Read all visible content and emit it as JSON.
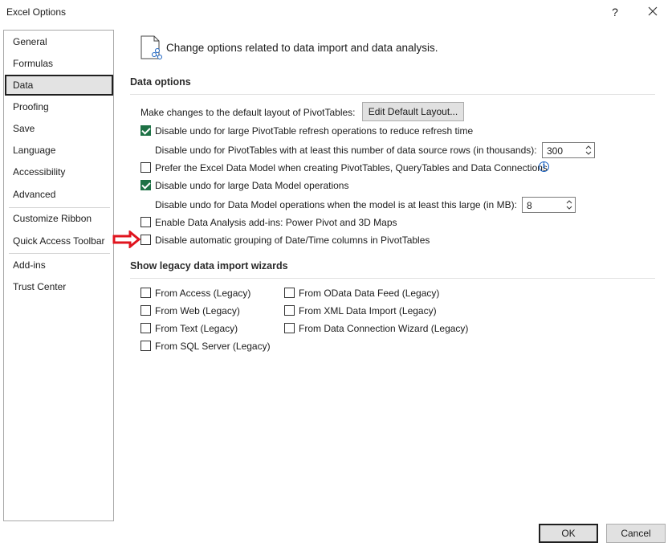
{
  "window": {
    "title": "Excel Options",
    "help_glyph": "?",
    "close_icon": "close-icon"
  },
  "sidebar": {
    "items": [
      {
        "label": "General",
        "selected": false
      },
      {
        "label": "Formulas",
        "selected": false
      },
      {
        "label": "Data",
        "selected": true
      },
      {
        "label": "Proofing",
        "selected": false
      },
      {
        "label": "Save",
        "selected": false
      },
      {
        "label": "Language",
        "selected": false
      },
      {
        "label": "Accessibility",
        "selected": false
      },
      {
        "label": "Advanced",
        "selected": false
      },
      {
        "label": "Customize Ribbon",
        "selected": false
      },
      {
        "label": "Quick Access Toolbar",
        "selected": false
      },
      {
        "label": "Add-ins",
        "selected": false
      },
      {
        "label": "Trust Center",
        "selected": false
      }
    ]
  },
  "header": {
    "icon": "document-data-icon",
    "text": "Change options related to data import and data analysis."
  },
  "data_options": {
    "title": "Data options",
    "default_layout_label": "Make changes to the default layout of PivotTables:",
    "edit_layout_button": "Edit Default Layout...",
    "disable_undo_pivot": {
      "label": "Disable undo for large PivotTable refresh operations to reduce refresh time",
      "checked": true
    },
    "pivot_rows_label": "Disable undo for PivotTables with at least this number of data source rows (in thousands):",
    "pivot_rows_value": "300",
    "prefer_data_model": {
      "label": "Prefer the Excel Data Model when creating PivotTables, QueryTables and Data Connections",
      "checked": false
    },
    "info_glyph": "i",
    "disable_undo_model": {
      "label": "Disable undo for large Data Model operations",
      "checked": true
    },
    "model_size_label": "Disable undo for Data Model operations when the model is at least this large (in MB):",
    "model_size_value": "8",
    "enable_addins": {
      "label": "Enable Data Analysis add-ins: Power Pivot and 3D Maps",
      "checked": false
    },
    "disable_grouping": {
      "label": "Disable automatic grouping of Date/Time columns in PivotTables",
      "checked": false
    }
  },
  "legacy": {
    "title": "Show legacy data import wizards",
    "left": [
      {
        "label": "From Access (Legacy)",
        "checked": false
      },
      {
        "label": "From Web (Legacy)",
        "checked": false
      },
      {
        "label": "From Text (Legacy)",
        "checked": false
      },
      {
        "label": "From SQL Server (Legacy)",
        "checked": false
      }
    ],
    "right": [
      {
        "label": "From OData Data Feed (Legacy)",
        "checked": false
      },
      {
        "label": "From XML Data Import (Legacy)",
        "checked": false
      },
      {
        "label": "From Data Connection Wizard (Legacy)",
        "checked": false
      }
    ]
  },
  "footer": {
    "ok_label": "OK",
    "cancel_label": "Cancel"
  },
  "colors": {
    "accent_check": "#1e7145",
    "annotation_arrow": "#e0141e"
  }
}
